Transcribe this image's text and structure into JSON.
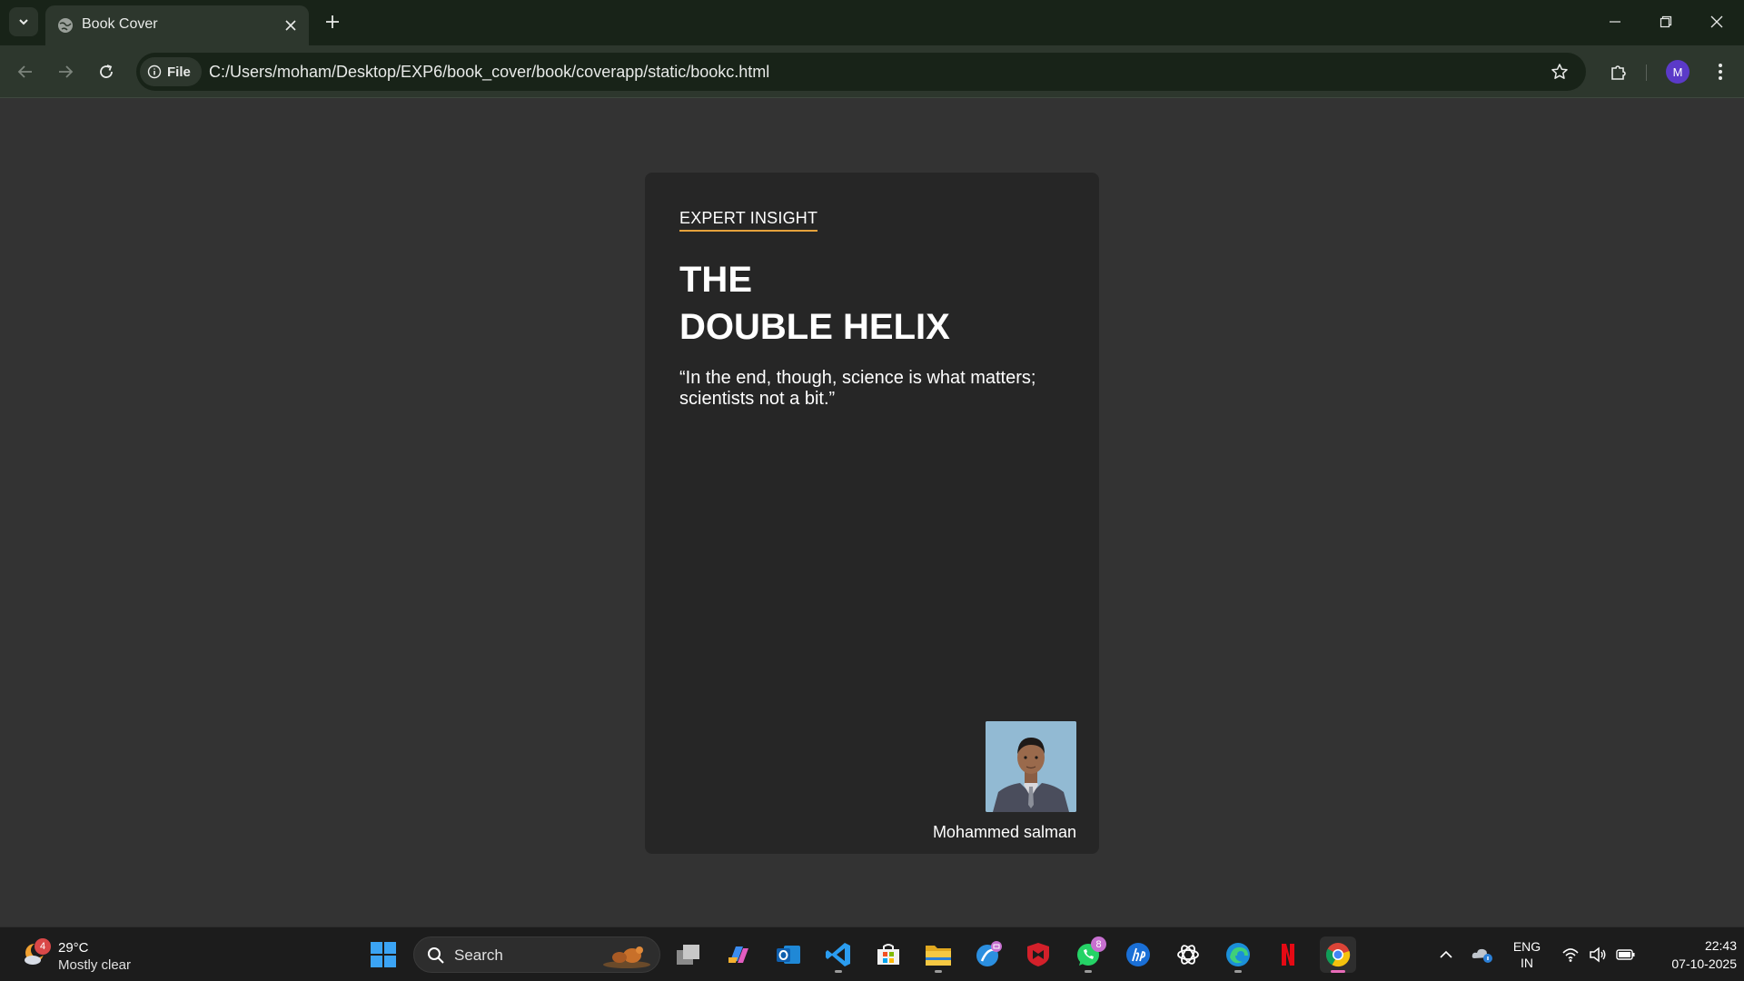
{
  "browser": {
    "tab": {
      "title": "Book Cover"
    },
    "omnibox": {
      "chip_label": "File",
      "url": "C:/Users/moham/Desktop/EXP6/book_cover/book/coverapp/static/bookc.html"
    },
    "profile_initial": "M"
  },
  "cover": {
    "series_label": "EXPERT INSIGHT",
    "title_line1": "THE",
    "title_line2": "DOUBLE HELIX",
    "quote": "“In the end, though, science is what matters; scientists not a bit.”",
    "author_name": "Mohammed salman",
    "accent_color": "#e6a23c"
  },
  "taskbar": {
    "weather": {
      "badge": "4",
      "temperature": "29°C",
      "condition": "Mostly clear"
    },
    "search_label": "Search",
    "apps": [
      {
        "name": "task-view-icon"
      },
      {
        "name": "copilot-icon"
      },
      {
        "name": "outlook-icon"
      },
      {
        "name": "vscode-icon",
        "running": true
      },
      {
        "name": "microsoft-store-icon"
      },
      {
        "name": "file-explorer-icon",
        "running": true
      },
      {
        "name": "feedback-mail-icon"
      },
      {
        "name": "mcafee-icon"
      },
      {
        "name": "whatsapp-icon",
        "badge": "8",
        "running": true
      },
      {
        "name": "hp-icon"
      },
      {
        "name": "chatgpt-icon"
      },
      {
        "name": "edge-icon",
        "running": true
      },
      {
        "name": "netflix-icon"
      },
      {
        "name": "chrome-icon",
        "active": true
      }
    ],
    "tray": {
      "language_line1": "ENG",
      "language_line2": "IN",
      "time": "22:43",
      "date": "07-10-2025"
    }
  }
}
